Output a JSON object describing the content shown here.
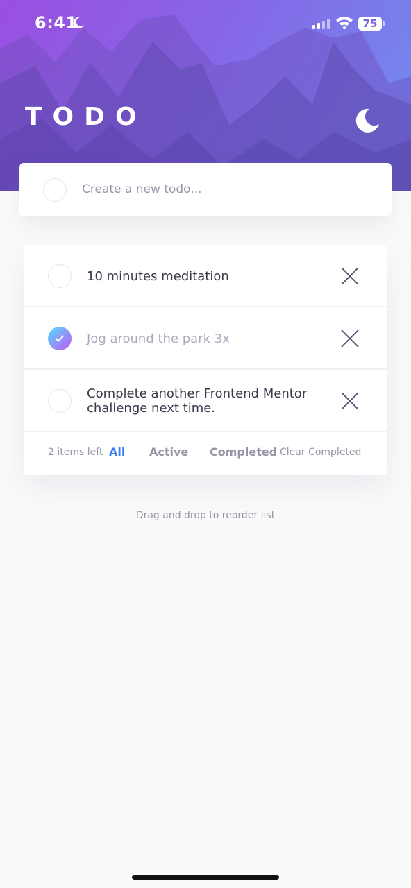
{
  "status_bar": {
    "time": "6:41",
    "battery": "75"
  },
  "header": {
    "title": "TODO"
  },
  "new_todo": {
    "placeholder": "Create a new todo..."
  },
  "todos": [
    {
      "text": "10 minutes meditation",
      "completed": false
    },
    {
      "text": "Jog around the park 3x",
      "completed": true
    },
    {
      "text": "Complete another Frontend Mentor challenge next time.",
      "completed": false
    }
  ],
  "footer": {
    "items_left": "2 items left",
    "filters": {
      "all": "All",
      "active": "Active",
      "completed": "Completed"
    },
    "active_filter": "All",
    "clear_completed": "Clear Completed"
  },
  "hint": "Drag and drop to reorder list",
  "colors": {
    "accent": "#3a7cfd",
    "check_gradient_start": "#55ddff",
    "check_gradient_end": "#c058f3"
  }
}
